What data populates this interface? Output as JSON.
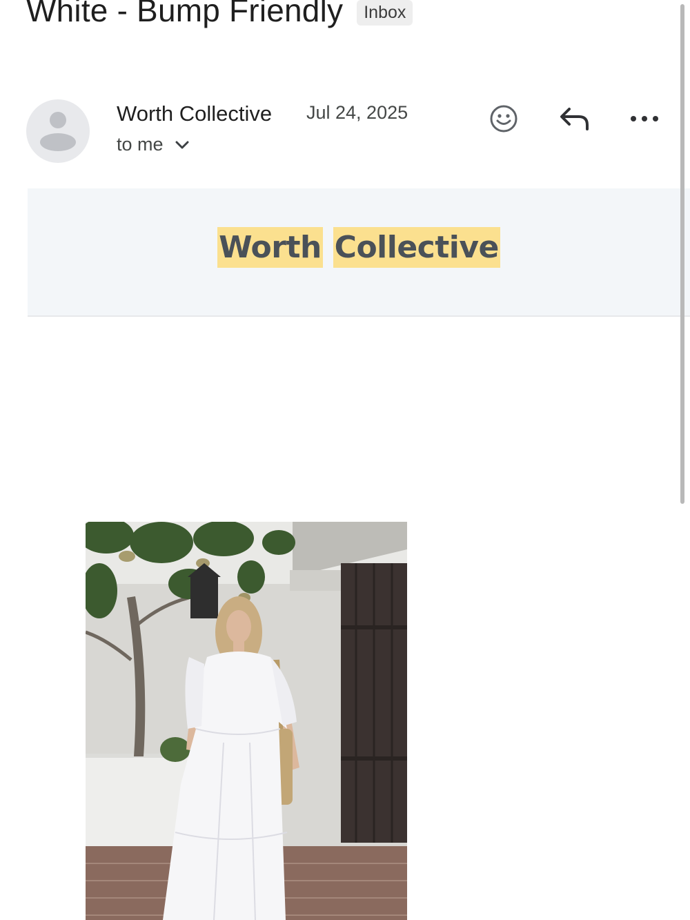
{
  "email": {
    "subject": "White - Bump Friendly",
    "label": "Inbox",
    "sender": "Worth Collective",
    "date": "Jul 24, 2025",
    "recipient": "to me"
  },
  "actions": {
    "emoji_icon": "emoji-reaction-icon",
    "reply_icon": "reply-icon",
    "more_icon": "more-horizontal-icon"
  },
  "body": {
    "brand_word1": "Worth",
    "brand_word2": "Collective"
  },
  "colors": {
    "banner_bg": "#f3f6f9",
    "brand_highlight": "#fbe08f",
    "brand_text": "#4a5158"
  }
}
